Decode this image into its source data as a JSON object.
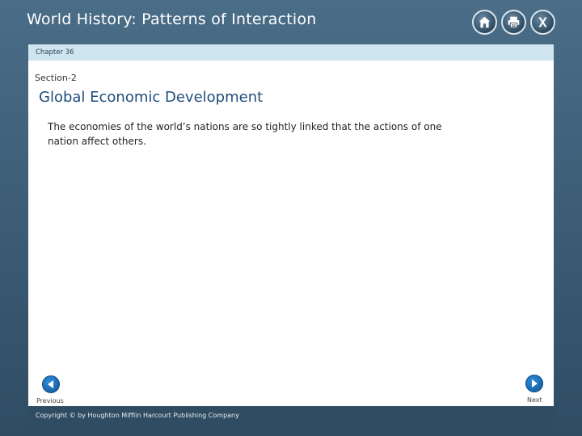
{
  "app": {
    "title": "World History: Patterns of Interaction"
  },
  "toolbar": {
    "icons": [
      "home-icon",
      "print-icon",
      "close-icon"
    ]
  },
  "chapter": {
    "label": "Chapter 36"
  },
  "section": {
    "label": "Section-2",
    "title": "Global Economic Development",
    "body": "The economies of the world’s nations are so tightly linked that the actions of one nation affect others."
  },
  "nav": {
    "previous_label": "Previous",
    "next_label": "Next"
  },
  "footer": {
    "copyright": "Copyright © by Houghton Mifflin Harcourt Publishing Company"
  },
  "colors": {
    "frame": "#3f5f78",
    "chapter_bar": "#cfe6f1",
    "title": "#1f4d7a",
    "nav_button": "#1f77c4"
  }
}
